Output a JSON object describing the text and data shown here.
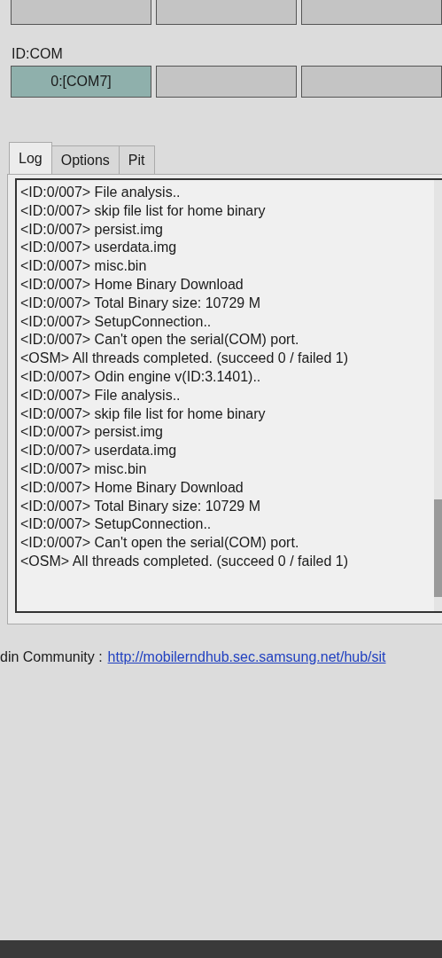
{
  "id_com_label": "ID:COM",
  "ports": [
    {
      "label": "0:[COM7]",
      "active": true
    },
    {
      "active": false
    },
    {
      "active": false
    }
  ],
  "tabs": [
    {
      "label": "Log",
      "selected": true
    },
    {
      "label": "Options",
      "selected": false
    },
    {
      "label": "Pit",
      "selected": false
    }
  ],
  "log_lines": [
    "<ID:0/007> File analysis..",
    "<ID:0/007> skip file list for home binary",
    "<ID:0/007> persist.img",
    "<ID:0/007> userdata.img",
    "<ID:0/007> misc.bin",
    "<ID:0/007> Home Binary Download",
    "<ID:0/007> Total Binary size: 10729 M",
    "<ID:0/007> SetupConnection..",
    "<ID:0/007> Can't open the serial(COM) port.",
    "<OSM> All threads completed. (succeed 0 / failed 1)",
    "<ID:0/007> Odin engine v(ID:3.1401)..",
    "<ID:0/007> File analysis..",
    "<ID:0/007> skip file list for home binary",
    "<ID:0/007> persist.img",
    "<ID:0/007> userdata.img",
    "<ID:0/007> misc.bin",
    "<ID:0/007> Home Binary Download",
    "<ID:0/007> Total Binary size: 10729 M",
    "<ID:0/007> SetupConnection..",
    "<ID:0/007> Can't open the serial(COM) port.",
    "<OSM> All threads completed. (succeed 0 / failed 1)"
  ],
  "footer": {
    "label": "din Community :",
    "link": "http://mobilerndhub.sec.samsung.net/hub/sit"
  }
}
